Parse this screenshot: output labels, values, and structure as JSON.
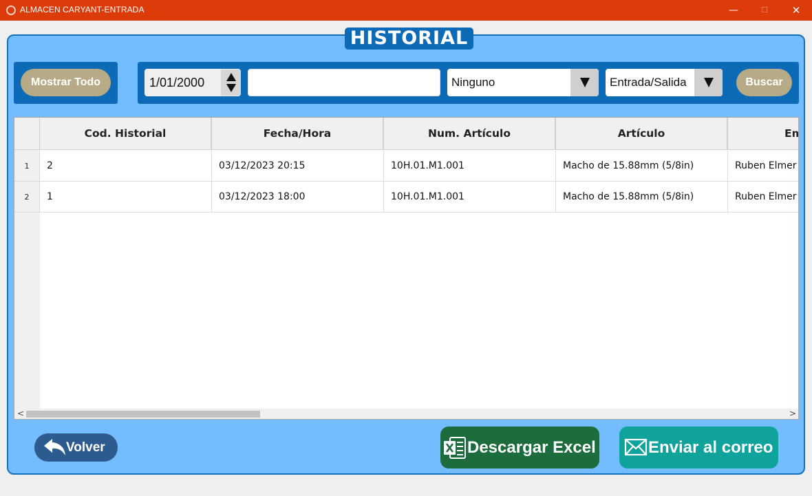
{
  "window": {
    "title": "ALMACEN CARYANT-ENTRADA",
    "minimize": "—",
    "maximize": "☐",
    "close": "✕"
  },
  "page": {
    "title": "HISTORIAL"
  },
  "filters": {
    "show_all_label": "Mostrar Todo",
    "date_value": "1/01/2000",
    "search_value": "",
    "field_select": "Ninguno",
    "type_select": "Entrada/Salida",
    "search_button": "Buscar"
  },
  "table": {
    "columns": [
      "Cod. Historial",
      "Fecha/Hora",
      "Num. Artículo",
      "Artículo",
      "Em"
    ],
    "rows": [
      {
        "num": "1",
        "cells": [
          "2",
          "03/12/2023 20:15",
          "10H.01.M1.001",
          "Macho de 15.88mm (5/8in)",
          "Ruben Elmer"
        ]
      },
      {
        "num": "2",
        "cells": [
          "1",
          "03/12/2023 18:00",
          "10H.01.M1.001",
          "Macho de 15.88mm (5/8in)",
          "Ruben Elmer"
        ]
      }
    ],
    "scroll_left": "<",
    "scroll_right": ">"
  },
  "actions": {
    "back": "Volver",
    "excel": "Descargar Excel",
    "email": "Enviar al correo"
  },
  "colors": {
    "titlebar": "#dc3b0a",
    "panel": "#73bcfd",
    "panel_border": "#1170b7",
    "accent_blue": "#0d6ab6",
    "pill_button": "#b7aa87",
    "back_button": "#2d5b8f",
    "excel_button": "#1d6c3d",
    "email_button": "#0fa39b"
  },
  "icons": {
    "app": "circle-icon",
    "back": "reply-arrow-icon",
    "excel": "excel-icon",
    "email": "envelope-icon"
  }
}
